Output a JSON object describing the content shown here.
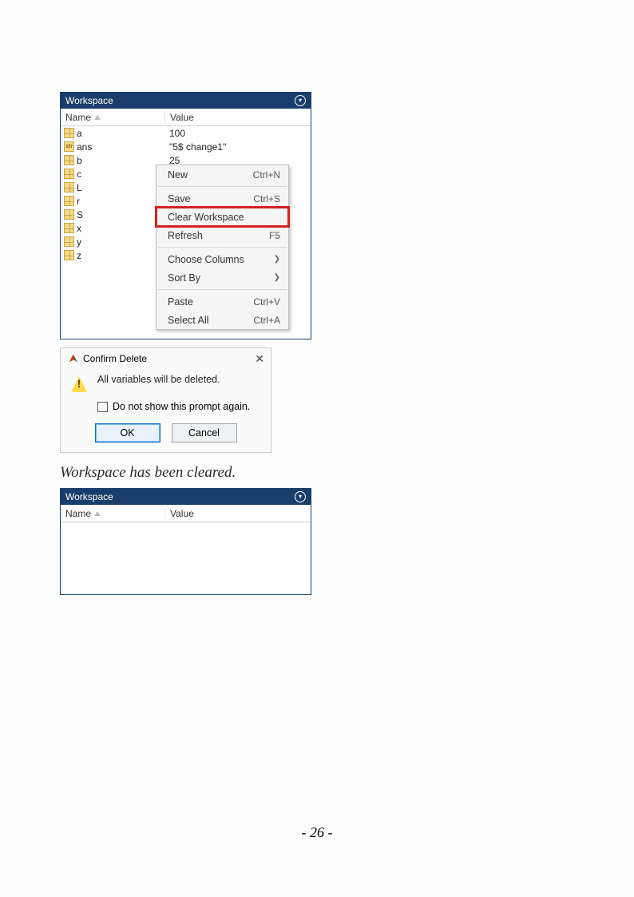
{
  "workspace1": {
    "title": "Workspace",
    "cols": {
      "name": "Name",
      "value": "Value"
    },
    "vars": [
      {
        "icon": "grid",
        "name": "a",
        "value": "100"
      },
      {
        "icon": "str",
        "name": "ans",
        "value": "\"5$ change1\""
      },
      {
        "icon": "grid",
        "name": "b",
        "value": "25"
      },
      {
        "icon": "grid",
        "name": "c",
        "value": ""
      },
      {
        "icon": "grid",
        "name": "L",
        "value": ""
      },
      {
        "icon": "grid",
        "name": "r",
        "value": ""
      },
      {
        "icon": "grid",
        "name": "S",
        "value": ""
      },
      {
        "icon": "grid",
        "name": "x",
        "value": ""
      },
      {
        "icon": "grid",
        "name": "y",
        "value": ""
      },
      {
        "icon": "grid",
        "name": "z",
        "value": ""
      }
    ]
  },
  "ctx": {
    "new": {
      "label": "New",
      "shortcut": "Ctrl+N"
    },
    "save": {
      "label": "Save",
      "shortcut": "Ctrl+S"
    },
    "clear": {
      "label": "Clear Workspace",
      "shortcut": ""
    },
    "refresh": {
      "label": "Refresh",
      "shortcut": "F5"
    },
    "cols": {
      "label": "Choose Columns",
      "sub": true
    },
    "sort": {
      "label": "Sort By",
      "sub": true
    },
    "paste": {
      "label": "Paste",
      "shortcut": "Ctrl+V"
    },
    "selall": {
      "label": "Select All",
      "shortcut": "Ctrl+A"
    }
  },
  "dialog": {
    "title": "Confirm Delete",
    "message": "All variables will be deleted.",
    "checkbox": "Do not show this prompt again.",
    "ok": "OK",
    "cancel": "Cancel"
  },
  "caption": "Workspace has been cleared.",
  "workspace2": {
    "title": "Workspace",
    "cols": {
      "name": "Name",
      "value": "Value"
    }
  },
  "page_number": "- 26 -"
}
